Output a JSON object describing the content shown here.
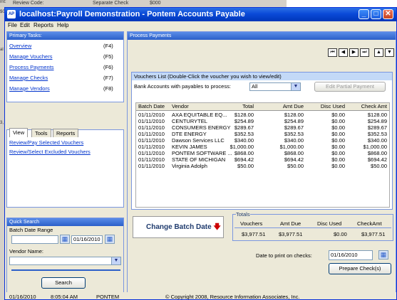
{
  "background": {
    "top_fields": [
      "Review Code:",
      "Separate Check",
      "$000"
    ],
    "left_fragments": [
      "rnt:",
      "$0.0",
      "al Si",
      "3, Re"
    ]
  },
  "window": {
    "title": "localhost:Payroll Demonstration - Pontem Accounts Payable",
    "app_icon": "AP"
  },
  "menu": [
    "File",
    "Edit",
    "Reports",
    "Help"
  ],
  "primary_tasks": {
    "header": "Primary Tasks:",
    "items": [
      {
        "label": "Overview",
        "key": "(F4)"
      },
      {
        "label": "Manage Vouchers",
        "key": "(F5)"
      },
      {
        "label": "Process Payments",
        "key": "(F6)"
      },
      {
        "label": "Manage Checks",
        "key": "(F7)"
      },
      {
        "label": "Manage Vendors",
        "key": "(F8)"
      }
    ]
  },
  "view_tabs": {
    "tabs": [
      "View",
      "Tools",
      "Reports"
    ],
    "links": [
      "Review/Pay Selected Vouchers",
      "Review/Select Excluded Vouchers"
    ]
  },
  "quick_search": {
    "header": "Quick Search",
    "batch_date_label": "Batch Date Range",
    "batch_date_from": "",
    "batch_date_to": "01/16/2010",
    "vendor_label": "Vendor Name:",
    "vendor_value": "",
    "search_button": "Search"
  },
  "process_payments": {
    "header": "Process Payments",
    "nav_buttons": [
      "first",
      "prev",
      "next",
      "last",
      "up",
      "down"
    ],
    "vouchers_header": "Vouchers List (Double-Click the voucher you wish to view/edit)",
    "bank_label": "Bank Accounts with payables to process:",
    "bank_value": "All",
    "edit_partial_button": "Edit Partial Payment",
    "columns": [
      "Batch Date",
      "Vendor",
      "Total",
      "Amt Due",
      "Disc Used",
      "Check Amt"
    ],
    "rows": [
      [
        "01/11/2010",
        "AXA EQUITABLE EQ...",
        "$128.00",
        "$128.00",
        "$0.00",
        "$128.00"
      ],
      [
        "01/11/2010",
        "CENTURYTEL",
        "$254.89",
        "$254.89",
        "$0.00",
        "$254.89"
      ],
      [
        "01/11/2010",
        "CONSUMERS ENERGY",
        "$289.67",
        "$289.67",
        "$0.00",
        "$289.67"
      ],
      [
        "01/11/2010",
        "DTE ENERGY",
        "$352.53",
        "$352.53",
        "$0.00",
        "$352.53"
      ],
      [
        "01/11/2010",
        "Dawson Services LLC",
        "$340.00",
        "$340.00",
        "$0.00",
        "$340.00"
      ],
      [
        "01/11/2010",
        "KEVIN JAMES",
        "$1,000.00",
        "$1,000.00",
        "$0.00",
        "$1,000.00"
      ],
      [
        "01/11/2010",
        "PONTEM SOFTWARE ...",
        "$868.00",
        "$868.00",
        "$0.00",
        "$868.00"
      ],
      [
        "01/11/2010",
        "STATE OF MICHIGAN",
        "$694.42",
        "$694.42",
        "$0.00",
        "$694.42"
      ],
      [
        "01/11/2010",
        "Virginia Adolph",
        "$50.00",
        "$50.00",
        "$0.00",
        "$50.00"
      ]
    ],
    "change_batch_button": "Change Batch Date",
    "totals": {
      "label": "Totals",
      "headers": [
        "Vouchers",
        "Amt Due",
        "Disc Used",
        "CheckAmt"
      ],
      "values": [
        "$3,977.51",
        "$3,977.51",
        "$0.00",
        "$3,977.51"
      ]
    },
    "print_date_label": "Date to print on checks:",
    "print_date_value": "01/16/2010",
    "prepare_button": "Prepare Check(s)"
  },
  "status_bar": {
    "date": "01/16/2010",
    "time": "8:05:04 AM",
    "user": "PONTEM",
    "copyright": "© Copyright 2008, Resource Information Associates, Inc."
  },
  "colors": {
    "title_bar": "#0a4ad8",
    "panel_header": "#2b5fc9",
    "link": "#0033cc",
    "window_bg": "#ece9d8"
  }
}
